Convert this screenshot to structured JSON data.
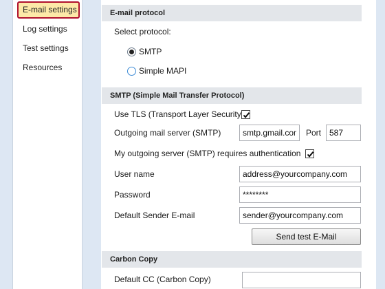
{
  "sidebar": {
    "items": [
      {
        "label": "E-mail settings",
        "active": true
      },
      {
        "label": "Log settings"
      },
      {
        "label": "Test settings"
      },
      {
        "label": "Resources"
      }
    ]
  },
  "email_protocol": {
    "header": "E-mail protocol",
    "select_label": "Select protocol:",
    "options": [
      {
        "label": "SMTP",
        "checked": true
      },
      {
        "label": "Simple MAPI",
        "checked": false
      }
    ]
  },
  "smtp": {
    "header": "SMTP (Simple Mail Transfer Protocol)",
    "use_tls_label": "Use TLS (Transport Layer Security)",
    "use_tls_checked": true,
    "server_label": "Outgoing mail server (SMTP)",
    "server_value": "smtp.gmail.com",
    "port_label": "Port",
    "port_value": "587",
    "auth_label": "My outgoing server (SMTP) requires authentication",
    "auth_checked": true,
    "username_label": "User name",
    "username_value": "address@yourcompany.com",
    "password_label": "Password",
    "password_value": "********",
    "sender_label": "Default Sender E-mail",
    "sender_value": "sender@yourcompany.com",
    "test_button": "Send test E-Mail"
  },
  "carbon_copy": {
    "header": "Carbon Copy",
    "cc_label": "Default CC (Carbon Copy)",
    "cc_value": ""
  }
}
